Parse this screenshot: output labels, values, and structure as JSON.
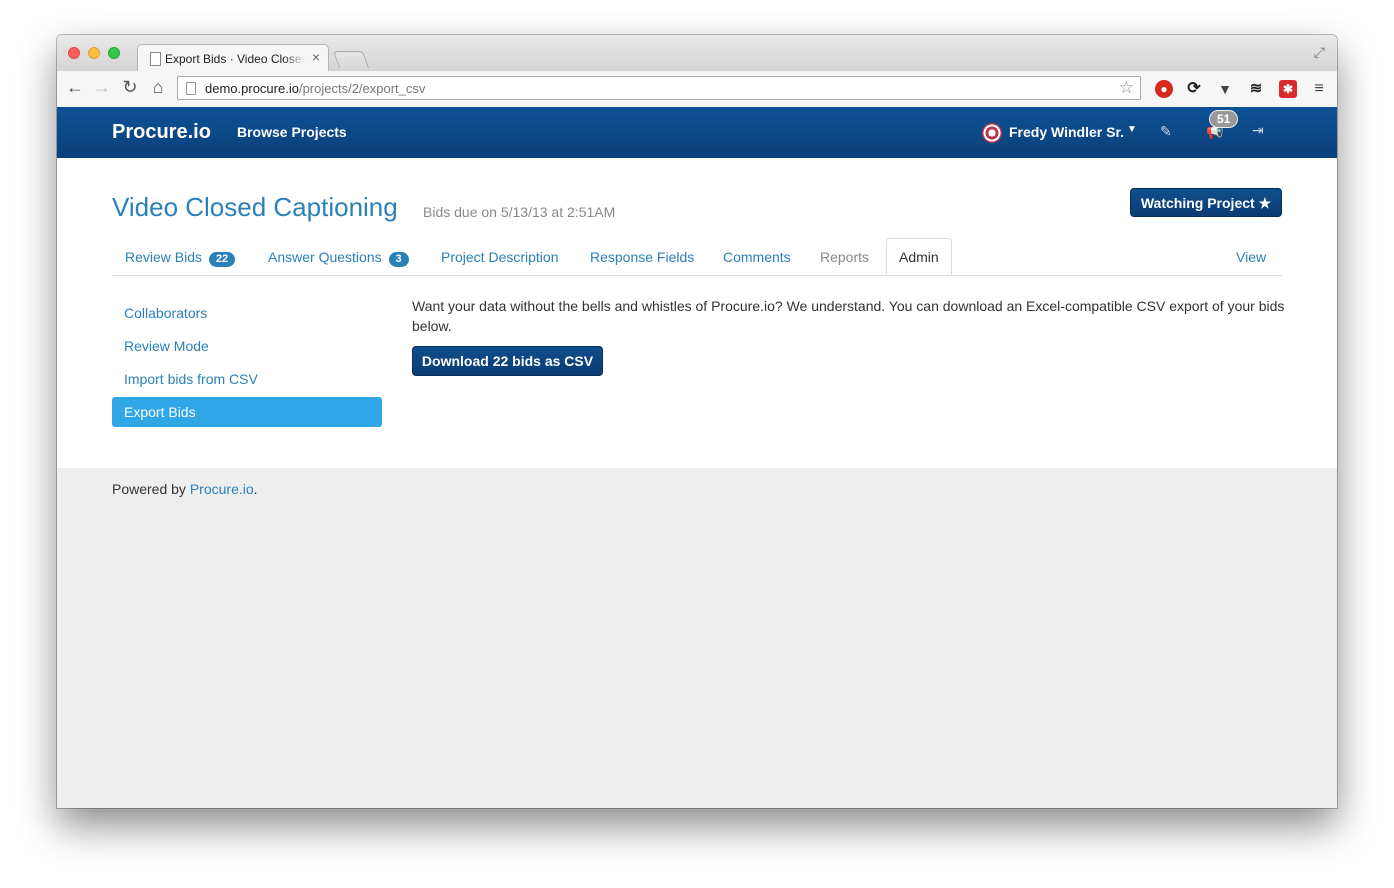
{
  "browser": {
    "tab_title": "Export Bids · Video Closed Captioning",
    "tab_close": "×",
    "url_host": "demo.procure.io",
    "url_path": "/projects/2/export_csv"
  },
  "navbar": {
    "brand": "Procure.io",
    "browse": "Browse Projects",
    "user_name": "Fredy Windler Sr.",
    "notifications_count": "51"
  },
  "project": {
    "title": "Video Closed Captioning",
    "bids_due": "Bids due on 5/13/13 at 2:51AM",
    "watch_label": "Watching Project ★"
  },
  "tabs": {
    "review_bids": "Review Bids",
    "review_bids_count": "22",
    "answer_questions": "Answer Questions",
    "answer_questions_count": "3",
    "project_description": "Project Description",
    "response_fields": "Response Fields",
    "comments": "Comments",
    "reports": "Reports",
    "admin": "Admin",
    "view": "View"
  },
  "sidenav": {
    "collaborators": "Collaborators",
    "review_mode": "Review Mode",
    "import_bids": "Import bids from CSV",
    "export_bids": "Export Bids"
  },
  "main": {
    "blurb": "Want your data without the bells and whistles of Procure.io? We understand. You can download an Excel-compatible CSV export of your bids below.",
    "download_label": "Download 22 bids as CSV"
  },
  "footer": {
    "prefix": "Powered by ",
    "link": "Procure.io",
    "suffix": "."
  },
  "colors": {
    "navbar": "#0e5296",
    "link": "#2a81b9",
    "active_sidebar": "#2fa7e7"
  }
}
